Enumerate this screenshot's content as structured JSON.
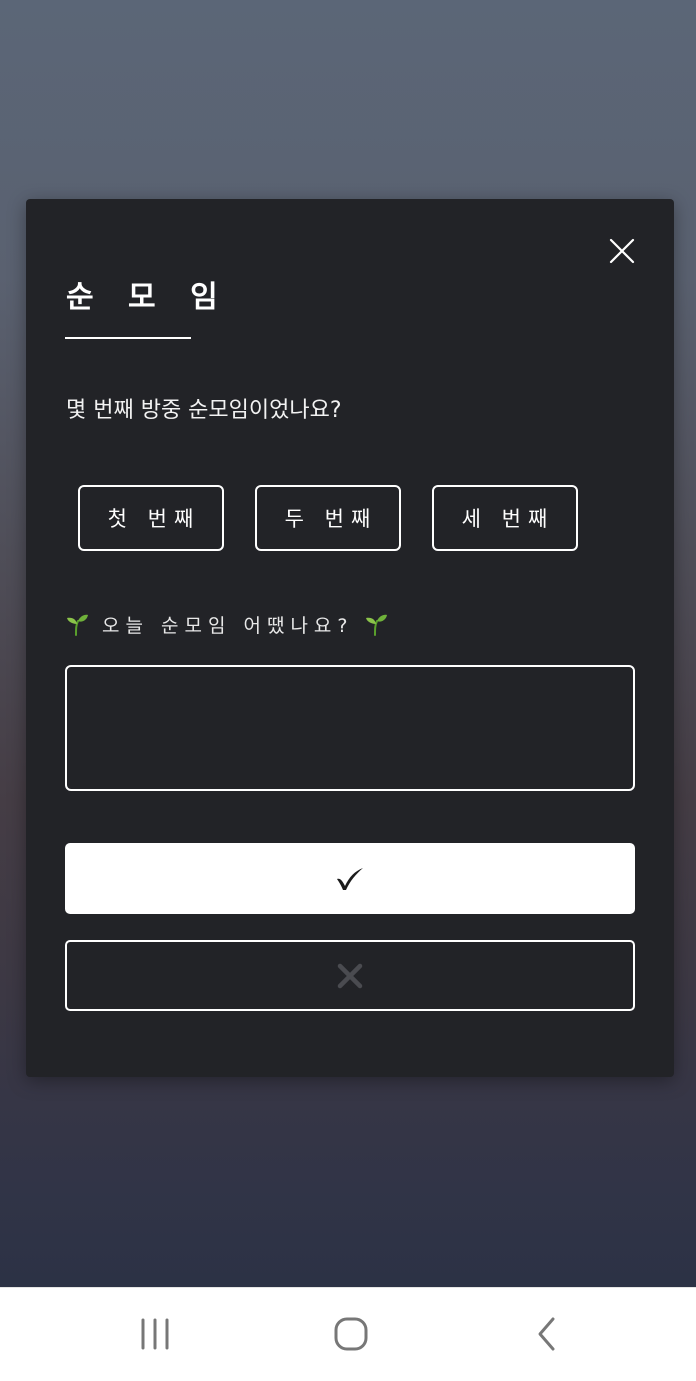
{
  "modal": {
    "title": "순 모 임",
    "question": "몇 번째 방중 순모임이었나요?",
    "choices": [
      {
        "label": "첫 번째"
      },
      {
        "label": "두 번째"
      },
      {
        "label": "세 번째"
      }
    ],
    "feedback_prompt": "오늘 순모임 어땠나요?",
    "feedback_value": "",
    "confirm_icon": "checkmark-icon",
    "cancel_icon": "x-icon",
    "close_icon": "close-icon",
    "prompt_icon": "sprout-icon"
  },
  "navbar": {
    "icons": [
      "recents-icon",
      "home-icon",
      "back-icon"
    ]
  },
  "colors": {
    "modal_bg": "#222327",
    "border": "#ffffff",
    "confirm_bg": "#ffffff",
    "cancel_icon": "#4a4b50",
    "navbar_bg": "#ffffff",
    "sprout_green": "#7cc23a"
  }
}
